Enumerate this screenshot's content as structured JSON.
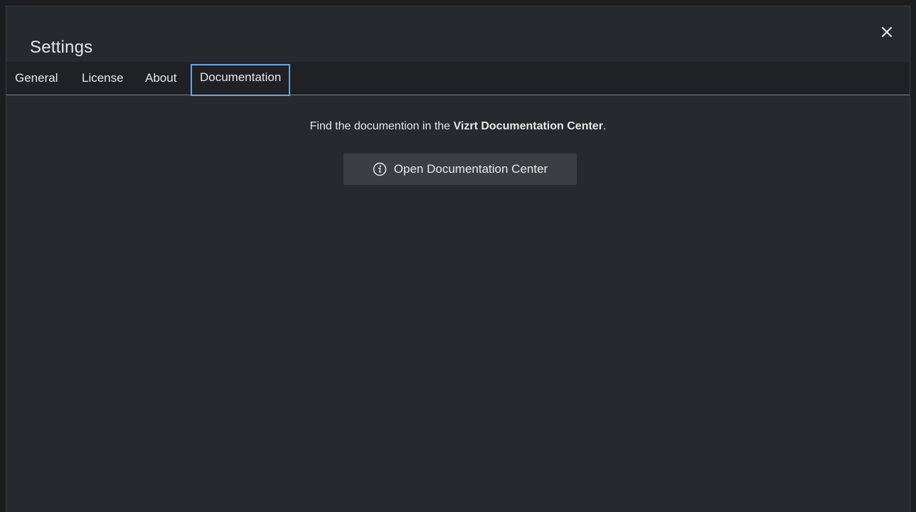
{
  "dialog": {
    "title": "Settings",
    "close_icon": "close-icon"
  },
  "tabs": [
    {
      "label": "General",
      "active": false
    },
    {
      "label": "License",
      "active": false
    },
    {
      "label": "About",
      "active": false
    },
    {
      "label": "Documentation",
      "active": true
    }
  ],
  "documentation": {
    "text_prefix": "Find the documention in the ",
    "text_strong": "Vizrt Documentation Center",
    "text_suffix": ".",
    "button_label": "Open Documentation Center",
    "button_icon": "info-icon"
  },
  "colors": {
    "background": "#26292d",
    "tab_bar": "#1f2124",
    "active_tab_border": "#6ea2e8",
    "button": "#3b3f43",
    "text": "#e6e7e8"
  }
}
